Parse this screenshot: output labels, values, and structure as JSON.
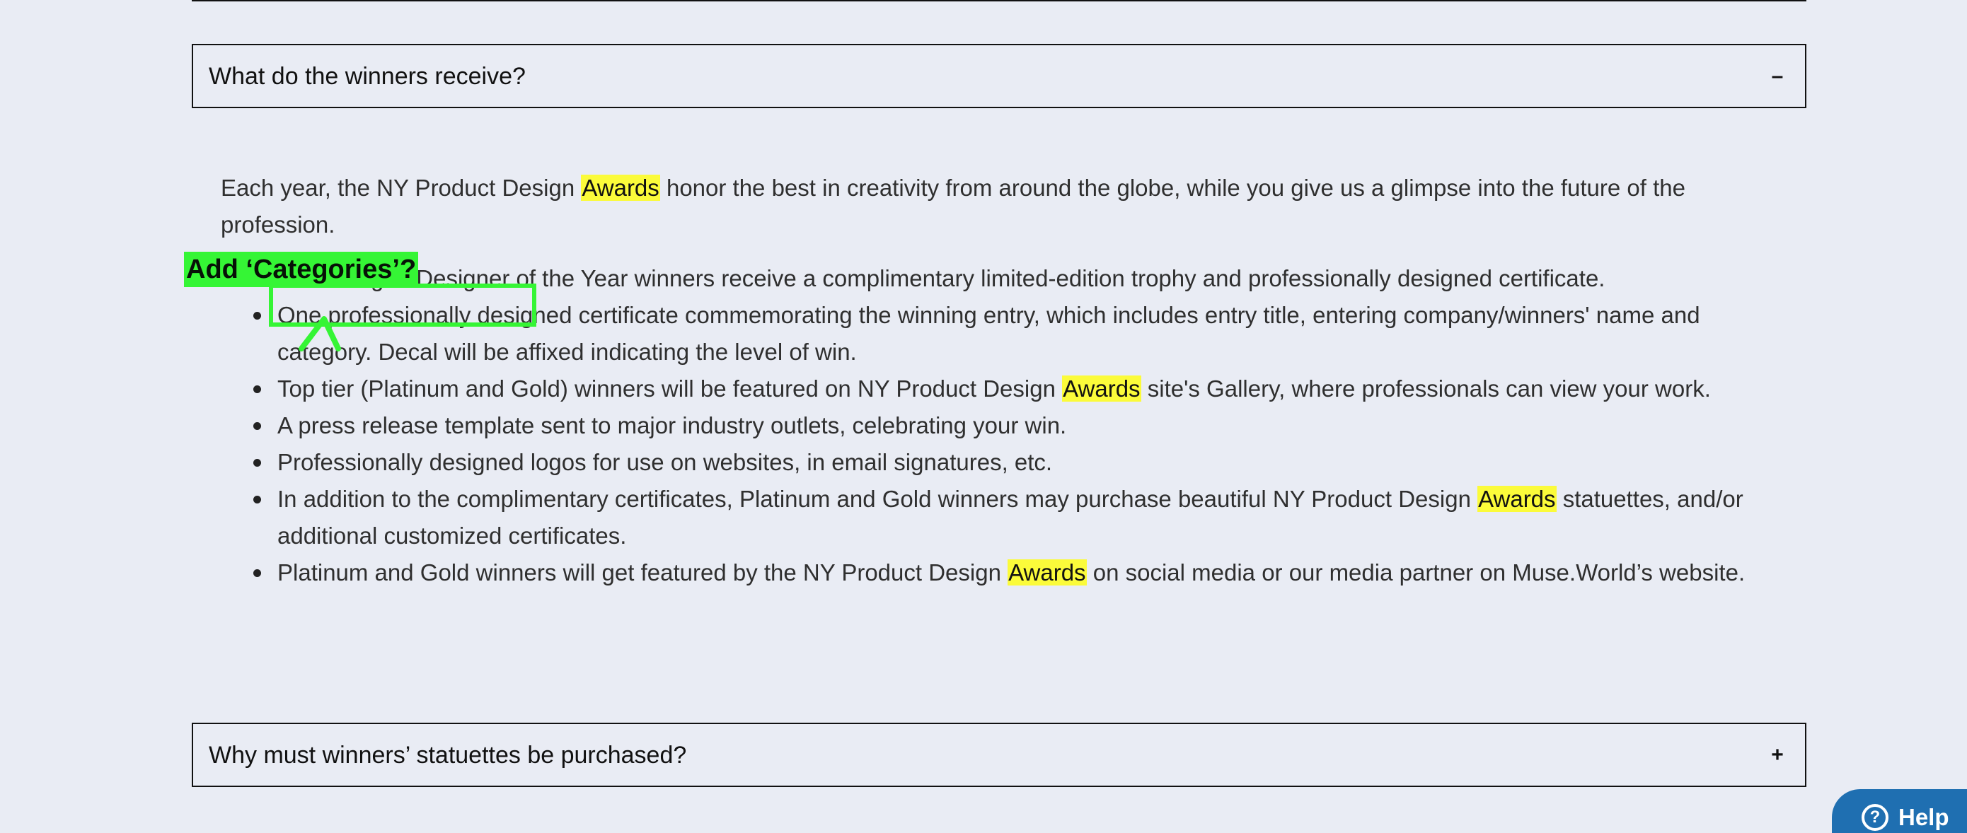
{
  "faq": {
    "items": [
      {
        "question": "What do the winners receive?",
        "toggle": "–",
        "expanded": true
      },
      {
        "question": "Why must winners’ statuettes be purchased?",
        "toggle": "+",
        "expanded": false
      }
    ],
    "answer": {
      "intro": {
        "before": "Each year, the NY Product Design ",
        "highlight": "Awards",
        "after": " honor the best in creativity from around the globe, while you give us a glimpse into the future of the profession."
      },
      "benefits": [
        {
          "text": "The Design / Designer of the Year winners receive a complimentary limited-edition trophy and professionally designed certificate."
        },
        {
          "text": "One professionally designed certificate commemorating the winning entry, which includes entry title, entering company/winners' name and category. Decal will be affixed indicating the level of win."
        },
        {
          "before": "Top tier (Platinum and Gold) winners will be featured on NY Product Design ",
          "highlight": "Awards",
          "after": " site's Gallery, where professionals can view your work."
        },
        {
          "text": "A press release template sent to major industry outlets, celebrating your win."
        },
        {
          "text": "Professionally designed logos for use on websites, in email signatures, etc."
        },
        {
          "before": "In addition to the complimentary certificates, Platinum and Gold winners may purchase beautiful NY Product Design ",
          "highlight": "Awards",
          "after": " statuettes, and/or additional customized certificates."
        },
        {
          "before": "Platinum and Gold winners will get featured by the NY Product Design ",
          "highlight": "Awards",
          "after": " on social media or our media partner on Muse.World’s website."
        }
      ]
    }
  },
  "annotation": {
    "label": "Add ‘Categories’?",
    "color": "#35f535"
  },
  "help_widget": {
    "label": "Help",
    "icon": "question-circle-icon",
    "color": "#1f6fb1"
  },
  "colors": {
    "background": "#e9ecf4",
    "highlight": "#fbfb3a",
    "text": "#2f2f2f"
  }
}
